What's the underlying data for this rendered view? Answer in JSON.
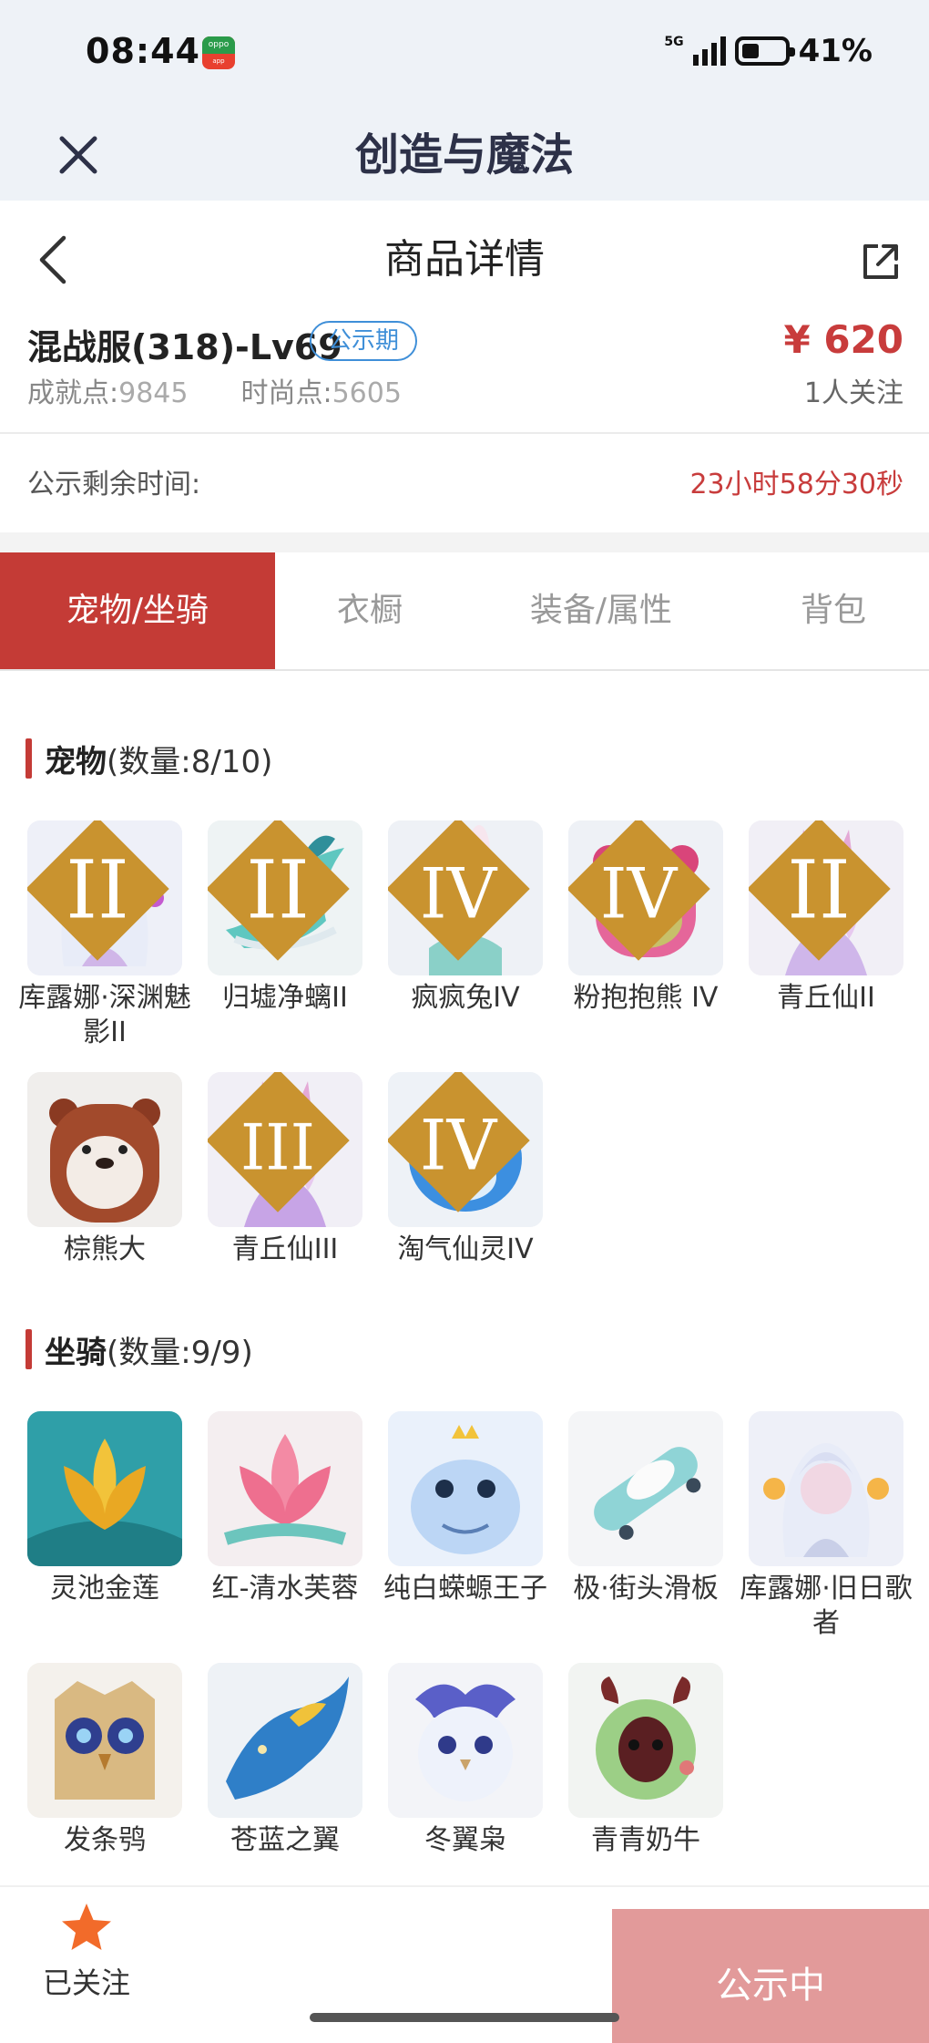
{
  "status_bar": {
    "time": "08:44",
    "network": "5G",
    "battery": "41%"
  },
  "app_header": {
    "title": "创造与魔法"
  },
  "nav": {
    "title": "商品详情"
  },
  "product": {
    "name": "混战服(318)-Lv69",
    "badge": "公示期",
    "achievement_label": "成就点:",
    "achievement_value": "9845",
    "fashion_label": "时尚点:",
    "fashion_value": "5605",
    "price": "¥ 620",
    "followers": "1人关注"
  },
  "countdown": {
    "label": "公示剩余时间:",
    "value": "23小时58分30秒"
  },
  "tabs": [
    {
      "label": "宠物/坐骑",
      "active": true
    },
    {
      "label": "衣橱",
      "active": false
    },
    {
      "label": "装备/属性",
      "active": false
    },
    {
      "label": "背包",
      "active": false
    }
  ],
  "pets": {
    "title": "宠物",
    "count": "(数量:8/10)",
    "items": [
      {
        "label": "库露娜·深渊魅影II",
        "rank": "II"
      },
      {
        "label": "归墟净螭II",
        "rank": "II"
      },
      {
        "label": "疯疯兔IV",
        "rank": "IV"
      },
      {
        "label": "粉抱抱熊 IV",
        "rank": "IV"
      },
      {
        "label": "青丘仙II",
        "rank": "II"
      },
      {
        "label": "棕熊大",
        "rank": ""
      },
      {
        "label": "青丘仙III",
        "rank": "III"
      },
      {
        "label": "淘气仙灵IV",
        "rank": "IV"
      }
    ]
  },
  "mounts": {
    "title": "坐骑",
    "count": "(数量:9/9)",
    "items": [
      {
        "label": "灵池金莲"
      },
      {
        "label": "红-清水芙蓉"
      },
      {
        "label": "纯白蝾螈王子"
      },
      {
        "label": "极·街头滑板"
      },
      {
        "label": "库露娜·旧日歌者"
      },
      {
        "label": "发条鸮"
      },
      {
        "label": "苍蓝之翼"
      },
      {
        "label": "冬翼枭"
      },
      {
        "label": "青青奶牛"
      }
    ]
  },
  "bottom_bar": {
    "follow_label": "已关注",
    "action_label": "公示中"
  },
  "colors": {
    "accent": "#c43b36",
    "price": "#c83c3c",
    "badge": "#3f8fd8",
    "cta": "#e29a9a",
    "star": "#f26b2a"
  }
}
